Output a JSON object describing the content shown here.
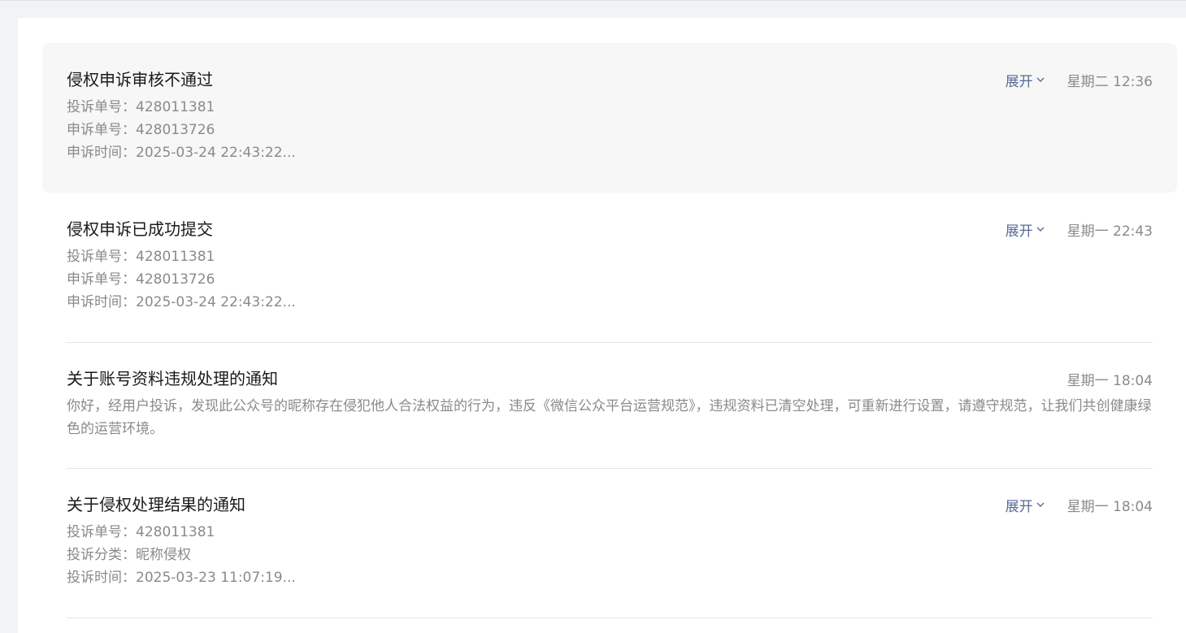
{
  "messages": [
    {
      "title": "侵权申诉审核不通过",
      "expand": "展开",
      "time": "星期二 12:36",
      "lines": [
        {
          "label": "投诉单号：",
          "value": "428011381"
        },
        {
          "label": "申诉单号：",
          "value": "428013726"
        },
        {
          "label": "申诉时间：",
          "value": "2025-03-24 22:43:22..."
        }
      ]
    },
    {
      "title": "侵权申诉已成功提交",
      "expand": "展开",
      "time": "星期一 22:43",
      "lines": [
        {
          "label": "投诉单号：",
          "value": "428011381"
        },
        {
          "label": "申诉单号：",
          "value": "428013726"
        },
        {
          "label": "申诉时间：",
          "value": "2025-03-24 22:43:22..."
        }
      ]
    },
    {
      "title": "关于账号资料违规处理的通知",
      "time": "星期一 18:04",
      "body": "你好，经用户投诉，发现此公众号的昵称存在侵犯他人合法权益的行为，违反《微信公众平台运营规范》，违规资料已清空处理，可重新进行设置，请遵守规范，让我们共创健康绿色的运营环境。"
    },
    {
      "title": "关于侵权处理结果的通知",
      "expand": "展开",
      "time": "星期一 18:04",
      "lines": [
        {
          "label": "投诉单号：",
          "value": "428011381"
        },
        {
          "label": "投诉分类：",
          "value": "昵称侵权"
        },
        {
          "label": "投诉时间：",
          "value": "2025-03-23 11:07:19..."
        }
      ]
    }
  ],
  "icons": {
    "expand": "chevron-down-icon"
  },
  "colors": {
    "link": "#576b95",
    "muted": "#8a8a8a",
    "title": "#1a1a1a",
    "highlight_bg": "#f7f7f7"
  }
}
